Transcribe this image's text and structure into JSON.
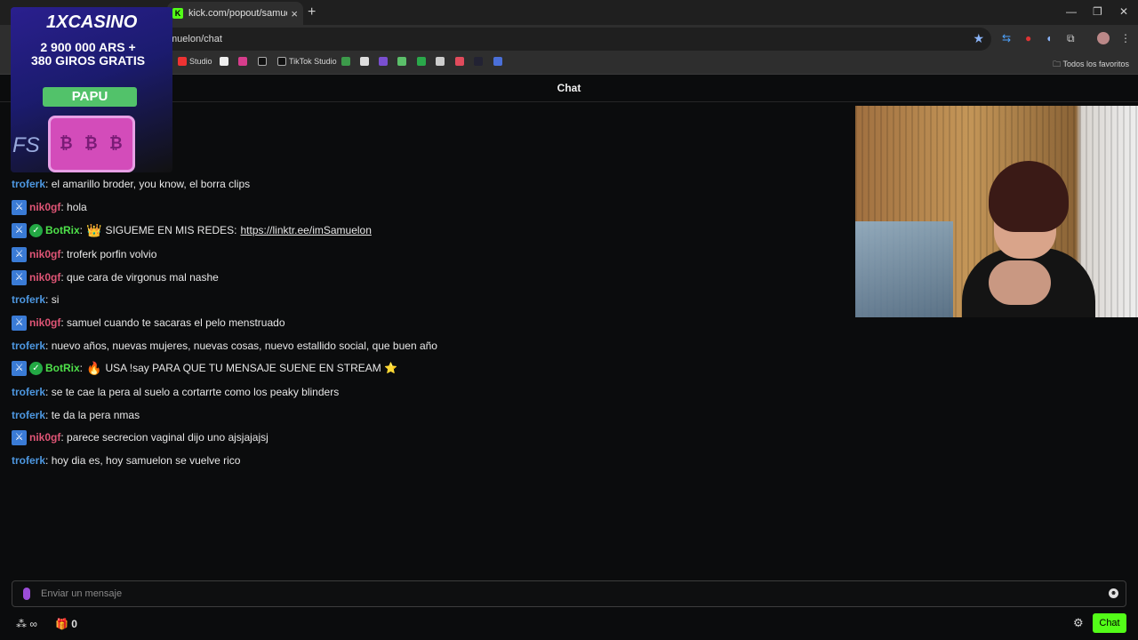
{
  "browser": {
    "tab_title": "kick.com/popout/samuelon/ch",
    "tab_favicon": "K",
    "url": "muelon/chat",
    "bookmarks": [
      {
        "label": "Studio",
        "icon": "youtube-icon"
      },
      {
        "label": "",
        "icon": "x-icon"
      },
      {
        "label": "",
        "icon": "instagram-icon"
      },
      {
        "label": "",
        "icon": "tiktok-icon"
      },
      {
        "label": "TikTok Studio",
        "icon": "tiktok-studio-icon"
      }
    ],
    "all_favorites": "Todos los favoritos"
  },
  "chat": {
    "header": "Chat",
    "messages": [
      {
        "user": "troferk",
        "color": "blue",
        "badges": [],
        "text": "el amarillo broder, you know, el borra clips"
      },
      {
        "user": "nik0gf",
        "color": "pink",
        "badges": [
          "moderator"
        ],
        "text": "hola"
      },
      {
        "user": "BotRix",
        "color": "green",
        "badges": [
          "moderator",
          "verified"
        ],
        "emote": "👑",
        "text": "SIGUEME EN MIS REDES:",
        "link": "https://linktr.ee/imSamuelon"
      },
      {
        "user": "nik0gf",
        "color": "pink",
        "badges": [
          "moderator"
        ],
        "text": "troferk porfin volvio"
      },
      {
        "user": "nik0gf",
        "color": "pink",
        "badges": [
          "moderator"
        ],
        "text": "que cara de virgonus mal nashe"
      },
      {
        "user": "troferk",
        "color": "blue",
        "badges": [],
        "text": "si"
      },
      {
        "user": "nik0gf",
        "color": "pink",
        "badges": [
          "moderator"
        ],
        "text": "samuel cuando te sacaras el pelo menstruado"
      },
      {
        "user": "troferk",
        "color": "blue",
        "badges": [],
        "text": "nuevo años, nuevas mujeres, nuevas cosas, nuevo estallido social, que buen año"
      },
      {
        "user": "BotRix",
        "color": "green",
        "badges": [
          "moderator",
          "verified"
        ],
        "emote": "🔥",
        "text": "USA !say PARA QUE TU MENSAJE SUENE EN STREAM ⭐"
      },
      {
        "user": "troferk",
        "color": "blue",
        "badges": [],
        "text": "se te cae la pera al suelo a cortarrte como los peaky blinders"
      },
      {
        "user": "troferk",
        "color": "blue",
        "badges": [],
        "text": "te da la pera nmas"
      },
      {
        "user": "nik0gf",
        "color": "pink",
        "badges": [
          "moderator"
        ],
        "text": "parece secrecion vaginal dijo uno ajsjajajsj"
      },
      {
        "user": "troferk",
        "color": "blue",
        "badges": [],
        "text": "hoy dia es, hoy samuelon se vuelve rico"
      }
    ],
    "input_placeholder": "Enviar un mensaje",
    "points": "∞",
    "gift_count": "0",
    "chat_button": "Chat"
  },
  "ad": {
    "brand": "1XCASINO",
    "promo_line1": "2 900 000 ARS +",
    "promo_line2": "380 GIROS GRATIS",
    "cta": "PAPU",
    "corner": "FS"
  },
  "colors": {
    "accent": "#53fc18",
    "user_blue": "#4d97e0",
    "user_pink": "#e05576",
    "user_green": "#4ee04a"
  }
}
